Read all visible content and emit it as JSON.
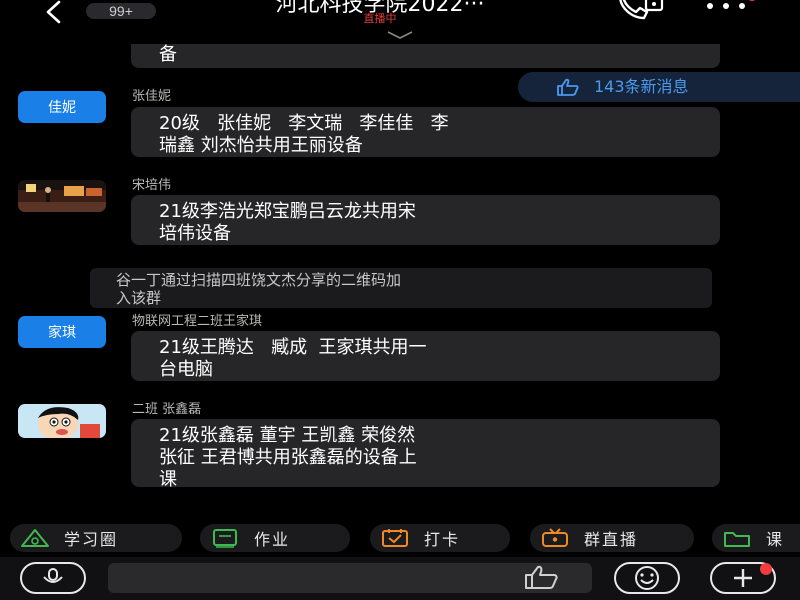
{
  "header": {
    "unread_badge": "99+",
    "title": "河北科技学院2022···",
    "status": "直播中",
    "colors": {
      "status": "#e23c3c",
      "more_dot": "#f03c3c"
    }
  },
  "new_messages": {
    "label": "143条新消息",
    "color": "#4a9bf0"
  },
  "messages": [
    {
      "lines": [
        "备"
      ]
    },
    {
      "sender": "张佳妮",
      "avatar_text": "佳妮",
      "lines": [
        "20级   张佳妮   李文瑞   李佳佳   李",
        "瑞鑫 刘杰怡共用王丽设备"
      ]
    },
    {
      "sender": "宋培伟",
      "avatar_icon": "photo-avatar-icon",
      "lines": [
        "21级李浩光郑宝鹏吕云龙共用宋",
        "培伟设备"
      ]
    },
    {
      "sender": "物联网工程二班王家琪",
      "avatar_text": "家琪",
      "lines": [
        "21级王腾达   臧成  王家琪共用一",
        "台电脑"
      ]
    },
    {
      "sender": "二班 张鑫磊",
      "avatar_icon": "cartoon-avatar-icon",
      "lines": [
        "21级张鑫磊 董宇 王凯鑫 荣俊然",
        "张征 王君博共用张鑫磊的设备上",
        "课"
      ]
    }
  ],
  "system_notice": {
    "lines": [
      "谷一丁通过扫描四班饶文杰分享的二维码加",
      "入该群"
    ]
  },
  "quick_bar": [
    {
      "label": "学习圈",
      "icon": "study-circle-icon",
      "color": "#3fb950"
    },
    {
      "label": "作业",
      "icon": "homework-icon",
      "color": "#3fb950"
    },
    {
      "label": "打卡",
      "icon": "checkin-icon",
      "color": "#f08a24"
    },
    {
      "label": "群直播",
      "icon": "live-tv-icon",
      "color": "#f08a24"
    },
    {
      "label": "课",
      "icon": "folder-icon",
      "color": "#3fb950"
    }
  ],
  "accent": "#1a7fe6"
}
